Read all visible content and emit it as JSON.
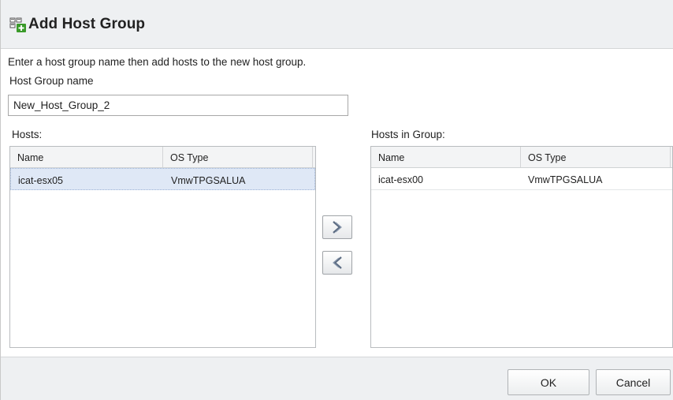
{
  "dialog": {
    "title": "Add Host Group",
    "title_icon": "add-host-group-icon"
  },
  "form": {
    "instructions": "Enter a host group name then add hosts to the new host group.",
    "name_label": "Host Group name",
    "name_value": "New_Host_Group_2"
  },
  "hosts": {
    "label": "Hosts:",
    "columns": [
      "Name",
      "OS Type"
    ],
    "rows": [
      {
        "name": "icat-esx05",
        "os_type": "VmwTPGSALUA",
        "selected": true
      }
    ]
  },
  "group": {
    "label": "Hosts in Group:",
    "columns": [
      "Name",
      "OS Type"
    ],
    "rows": [
      {
        "name": "icat-esx00",
        "os_type": "VmwTPGSALUA",
        "selected": false
      }
    ]
  },
  "move_buttons": {
    "add_icon": "double-chevron-right-icon",
    "remove_icon": "double-chevron-left-icon"
  },
  "footer": {
    "ok_label": "OK",
    "cancel_label": "Cancel"
  },
  "colors": {
    "header_bg": "#eef0f2",
    "selected_row": "#dfe8f6",
    "icon_green": "#3a9a2a"
  }
}
